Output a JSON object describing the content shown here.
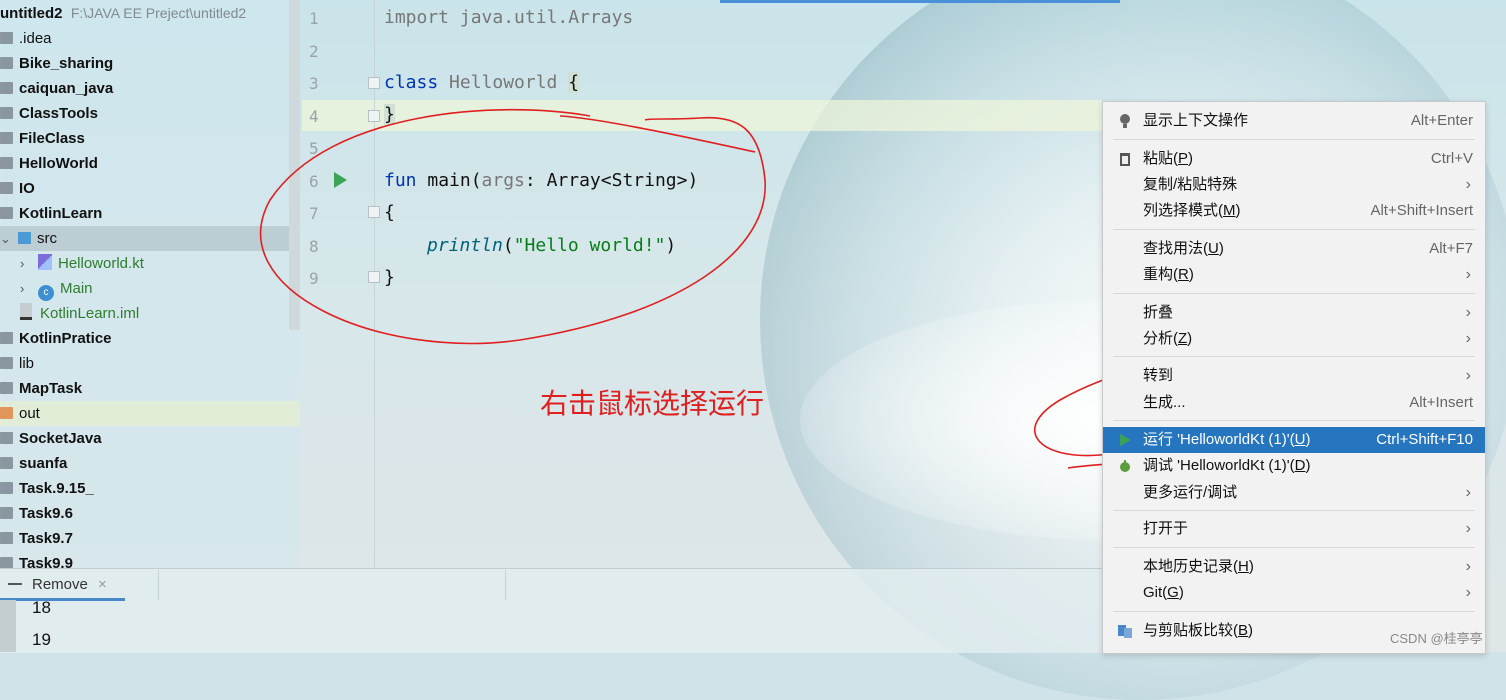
{
  "project": {
    "root_name": "untitled2",
    "root_path": "F:\\JAVA EE Preject\\untitled2",
    "items": [
      {
        "label": ".idea",
        "bold": false
      },
      {
        "label": "Bike_sharing",
        "bold": true
      },
      {
        "label": "caiquan_java",
        "bold": true
      },
      {
        "label": "ClassTools",
        "bold": true
      },
      {
        "label": "FileClass",
        "bold": true
      },
      {
        "label": "HelloWorld",
        "bold": true
      },
      {
        "label": "IO",
        "bold": true
      },
      {
        "label": "KotlinLearn",
        "bold": true
      },
      {
        "label": "src",
        "bold": false
      },
      {
        "label": "Helloworld.kt",
        "bold": false
      },
      {
        "label": "Main",
        "bold": false
      },
      {
        "label": "KotlinLearn.iml",
        "bold": false
      },
      {
        "label": "KotlinPratice",
        "bold": true
      },
      {
        "label": "lib",
        "bold": false
      },
      {
        "label": "MapTask",
        "bold": true
      },
      {
        "label": "out",
        "bold": false
      },
      {
        "label": "SocketJava",
        "bold": true
      },
      {
        "label": "suanfa",
        "bold": true
      },
      {
        "label": "Task.9.15_",
        "bold": true
      },
      {
        "label": "Task9.6",
        "bold": true
      },
      {
        "label": "Task9.7",
        "bold": true
      },
      {
        "label": "Task9.9",
        "bold": true
      }
    ]
  },
  "editor": {
    "line_numbers": [
      "1",
      "2",
      "3",
      "4",
      "5",
      "6",
      "7",
      "8",
      "9"
    ],
    "lines": {
      "l1_kw": "import",
      "l1_rest": " java.util.Arrays",
      "l3_kw": "class",
      "l3_name": " Helloworld ",
      "l3_brace": "{",
      "l4": "}",
      "l6_kw": "fun",
      "l6_name": " main(",
      "l6_arg": "args",
      "l6_rest": ": Array<String>)",
      "l7": "{",
      "l8_fn": "println",
      "l8_open": "(",
      "l8_str": "\"Hello world!\"",
      "l8_close": ")",
      "l9": "}"
    }
  },
  "annotation": {
    "text": "右击鼠标选择运行"
  },
  "bottom_panel": {
    "tab_label": "Remove",
    "tab_close": "×",
    "numbers": [
      "18",
      "19"
    ]
  },
  "context_menu": {
    "items": [
      {
        "label": "显示上下文操作",
        "shortcut": "Alt+Enter",
        "icon": "bulb-icon"
      },
      {
        "label": "粘贴(",
        "mn": "P",
        "tail": ")",
        "shortcut": "Ctrl+V",
        "icon": "clipboard-icon"
      },
      {
        "label": "复制/粘贴特殊",
        "submenu": true
      },
      {
        "label": "列选择模式(",
        "mn": "M",
        "tail": ")",
        "shortcut": "Alt+Shift+Insert"
      },
      {
        "label": "查找用法(",
        "mn": "U",
        "tail": ")",
        "shortcut": "Alt+F7"
      },
      {
        "label": "重构(",
        "mn": "R",
        "tail": ")",
        "submenu": true
      },
      {
        "label": "折叠",
        "submenu": true
      },
      {
        "label": "分析(",
        "mn": "Z",
        "tail": ")",
        "submenu": true
      },
      {
        "label": "转到",
        "submenu": true
      },
      {
        "label": "生成...",
        "shortcut": "Alt+Insert"
      },
      {
        "label": "运行 'HelloworldKt (1)'(",
        "mn": "U",
        "tail": ")",
        "shortcut": "Ctrl+Shift+F10",
        "icon": "run-icon",
        "active": true
      },
      {
        "label": "调试 'HelloworldKt (1)'(",
        "mn": "D",
        "tail": ")",
        "icon": "debug-icon"
      },
      {
        "label": "更多运行/调试",
        "submenu": true
      },
      {
        "label": "打开于",
        "submenu": true
      },
      {
        "label": "本地历史记录(",
        "mn": "H",
        "tail": ")",
        "submenu": true
      },
      {
        "label": "Git(",
        "mn": "G",
        "tail": ")",
        "submenu": true
      },
      {
        "label": "与剪贴板比较(",
        "mn": "B",
        "tail": ")",
        "icon": "compare-icon"
      }
    ],
    "submenu_glyph": "›"
  },
  "watermark": "CSDN @桂亭亭",
  "colors": {
    "run_green": "#3aa356",
    "menu_selected": "#2675bf",
    "annotation_red": "#e02020"
  }
}
